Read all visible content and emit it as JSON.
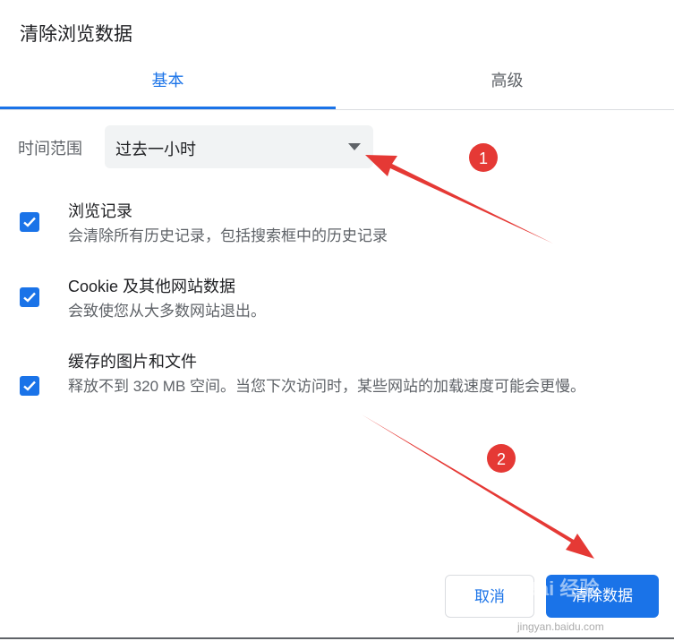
{
  "dialog": {
    "title": "清除浏览数据"
  },
  "tabs": [
    {
      "label": "基本",
      "active": true
    },
    {
      "label": "高级",
      "active": false
    }
  ],
  "time_range": {
    "label": "时间范围",
    "selected": "过去一小时"
  },
  "options": [
    {
      "title": "浏览记录",
      "description": "会清除所有历史记录，包括搜索框中的历史记录",
      "checked": true
    },
    {
      "title": "Cookie 及其他网站数据",
      "description": "会致使您从大多数网站退出。",
      "checked": true
    },
    {
      "title": "缓存的图片和文件",
      "description": "释放不到 320 MB 空间。当您下次访问时，某些网站的加载速度可能会更慢。",
      "checked": true
    }
  ],
  "buttons": {
    "cancel": "取消",
    "clear": "清除数据"
  },
  "annotations": {
    "badge1": "1",
    "badge2": "2",
    "color": "#e53935"
  },
  "watermark": {
    "brand": "Bai 经验",
    "url": "jingyan.baidu.com"
  },
  "colors": {
    "accent": "#1a73e8",
    "annotation": "#e53935"
  }
}
